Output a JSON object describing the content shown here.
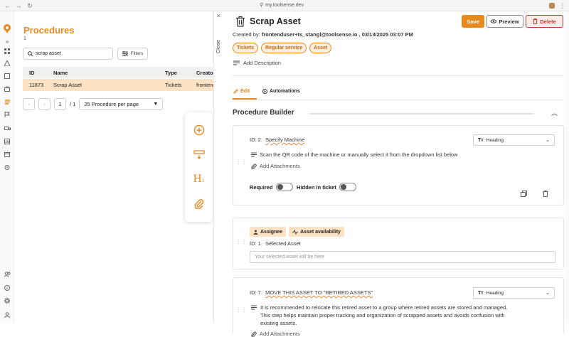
{
  "browser": {
    "url": "my.toolsense.dev"
  },
  "left": {
    "title": "Procedures",
    "count": "1",
    "search_value": "scrap asset",
    "filters_label": "Filters",
    "columns": [
      "ID",
      "Name",
      "Type",
      "Creator"
    ],
    "rows": [
      {
        "id": "11873",
        "name": "Scrap Asset",
        "type": "Tickets",
        "creator": "frontendu"
      }
    ],
    "page": "1",
    "page_total": "/ 1",
    "per_page": "25 Procedure per page"
  },
  "close_label": "Close",
  "detail": {
    "title": "Scrap Asset",
    "save_label": "Save",
    "preview_label": "Preview",
    "delete_label": "Delete",
    "created_by_label": "Created by:",
    "created_by_value": "frontenduser+ts_stangl@toolsense.io , 03/13/2025 03:07 PM",
    "tags": [
      "Tickets",
      "Regular service",
      "Asset"
    ],
    "add_description": "Add Description",
    "tab_edit": "Edit",
    "tab_automations": "Automations",
    "builder_title": "Procedure Builder"
  },
  "steps": [
    {
      "id_label": "ID: 2.",
      "name": "Specify Machine",
      "type": "Heading",
      "description": "Scan the QR code of the machine or manually select it from the dropdown list below",
      "add_attachments": "Add Attachments",
      "required_label": "Required",
      "hidden_label": "Hidden in ticket"
    },
    {
      "chips": [
        "Assignee",
        "Asset availability"
      ],
      "id_label": "ID: 1.",
      "name": "Selected Asset",
      "placeholder": "Your selected asset will be here"
    },
    {
      "id_label": "ID: 7.",
      "name": "MOVE THIS ASSET TO \"RETIRED ASSETS\"",
      "type": "Heading",
      "description_1": "It is recommended to relocate this retired asset to a group where retired assets are stored and managed.",
      "description_2": "This step helps maintain proper tracking and organization of scrapped assets and avoids confusion with",
      "description_3": "existing assets.",
      "add_attachments": "Add Attachments"
    }
  ],
  "colors": {
    "accent": "#e8891d",
    "danger": "#c0392b",
    "row_highlight": "#fde2c4"
  }
}
